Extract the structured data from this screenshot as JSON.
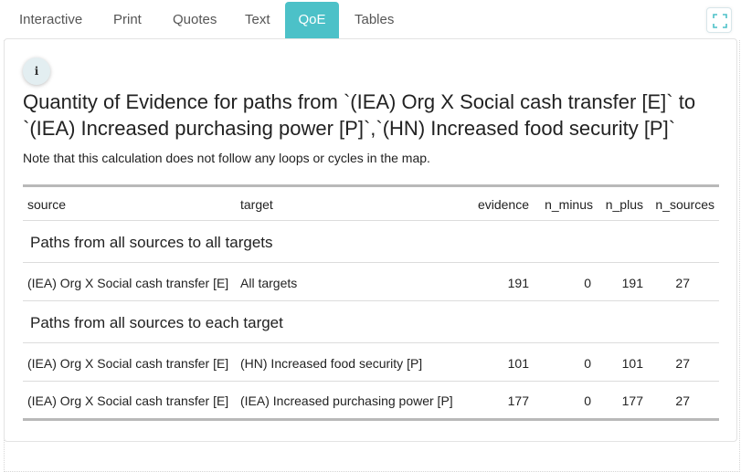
{
  "tabs": [
    {
      "label": "Interactive",
      "active": false
    },
    {
      "label": "Print",
      "active": false
    },
    {
      "label": "Quotes",
      "active": false
    },
    {
      "label": "Text",
      "active": false
    },
    {
      "label": "QoE",
      "active": true
    },
    {
      "label": "Tables",
      "active": false
    }
  ],
  "colors": {
    "accent": "#4cc1c8"
  },
  "info_icon": "i",
  "expand_icon": "expand-icon",
  "title": "Quantity of Evidence for paths from `(IEA) Org X Social cash transfer [E]` to `(IEA) Increased purchasing power [P]`,`(HN) Increased food security [P]`",
  "note": "Note that this calculation does not follow any loops or cycles in the map.",
  "table": {
    "columns": [
      "source",
      "target",
      "evidence",
      "n_minus",
      "n_plus",
      "n_sources"
    ],
    "groups": [
      {
        "label": "Paths from all sources to all targets",
        "rows": [
          {
            "source": "(IEA) Org X Social cash transfer [E]",
            "target": "All targets",
            "evidence": "191",
            "n_minus": "0",
            "n_plus": "191",
            "n_sources": "27"
          }
        ]
      },
      {
        "label": "Paths from all sources to each target",
        "rows": [
          {
            "source": "(IEA) Org X Social cash transfer [E]",
            "target": "(HN) Increased food security [P]",
            "evidence": "101",
            "n_minus": "0",
            "n_plus": "101",
            "n_sources": "27"
          },
          {
            "source": "(IEA) Org X Social cash transfer [E]",
            "target": "(IEA) Increased purchasing power [P]",
            "evidence": "177",
            "n_minus": "0",
            "n_plus": "177",
            "n_sources": "27"
          }
        ]
      }
    ]
  }
}
